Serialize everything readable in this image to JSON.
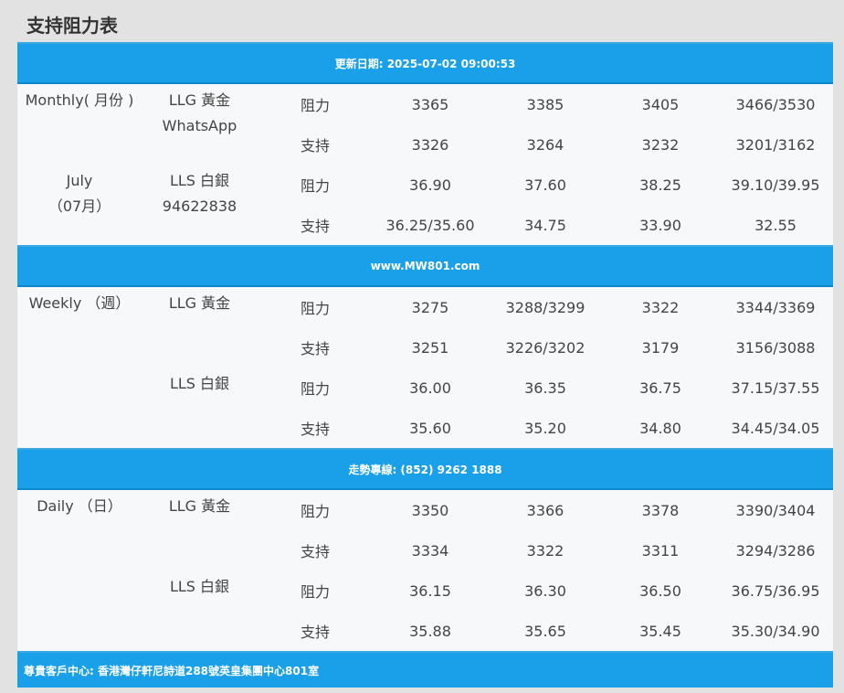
{
  "page_title": "支持阻力表",
  "banner_update": "更新日期: 2025-07-02 09:00:53",
  "banner_site": "www.MW801.com",
  "banner_hotline": "走勢專線: (852) 9262 1888",
  "footer_address": "尊貴客戶中心: 香港灣仔軒尼詩道288號英皇集團中心801室",
  "monthly": {
    "period_line1": "Monthly( 月份 )",
    "period_line2": "July",
    "period_line3": "（07月）",
    "gold_label": "LLG 黃金",
    "gold_sub": "WhatsApp",
    "silver_label": "LLS 白銀",
    "silver_sub": "94622838",
    "rows": [
      {
        "type": "阻力",
        "v1": "3365",
        "v2": "3385",
        "v3": "3405",
        "v4": "3466/3530"
      },
      {
        "type": "支持",
        "v1": "3326",
        "v2": "3264",
        "v3": "3232",
        "v4": "3201/3162"
      },
      {
        "type": "阻力",
        "v1": "36.90",
        "v2": "37.60",
        "v3": "38.25",
        "v4": "39.10/39.95"
      },
      {
        "type": "支持",
        "v1": "36.25/35.60",
        "v2": "34.75",
        "v3": "33.90",
        "v4": "32.55"
      }
    ]
  },
  "weekly": {
    "period_line1": "Weekly （週）",
    "gold_label": "LLG 黃金",
    "silver_label": "LLS 白銀",
    "rows": [
      {
        "type": "阻力",
        "v1": "3275",
        "v2": "3288/3299",
        "v3": "3322",
        "v4": "3344/3369"
      },
      {
        "type": "支持",
        "v1": "3251",
        "v2": "3226/3202",
        "v3": "3179",
        "v4": "3156/3088"
      },
      {
        "type": "阻力",
        "v1": "36.00",
        "v2": "36.35",
        "v3": "36.75",
        "v4": "37.15/37.55"
      },
      {
        "type": "支持",
        "v1": "35.60",
        "v2": "35.20",
        "v3": "34.80",
        "v4": "34.45/34.05"
      }
    ]
  },
  "daily": {
    "period_line1": "Daily （日）",
    "gold_label": "LLG 黃金",
    "silver_label": "LLS 白銀",
    "rows": [
      {
        "type": "阻力",
        "v1": "3350",
        "v2": "3366",
        "v3": "3378",
        "v4": "3390/3404"
      },
      {
        "type": "支持",
        "v1": "3334",
        "v2": "3322",
        "v3": "3311",
        "v4": "3294/3286"
      },
      {
        "type": "阻力",
        "v1": "36.15",
        "v2": "36.30",
        "v3": "36.50",
        "v4": "36.75/36.95"
      },
      {
        "type": "支持",
        "v1": "35.88",
        "v2": "35.65",
        "v3": "35.45",
        "v4": "35.30/34.90"
      }
    ]
  }
}
